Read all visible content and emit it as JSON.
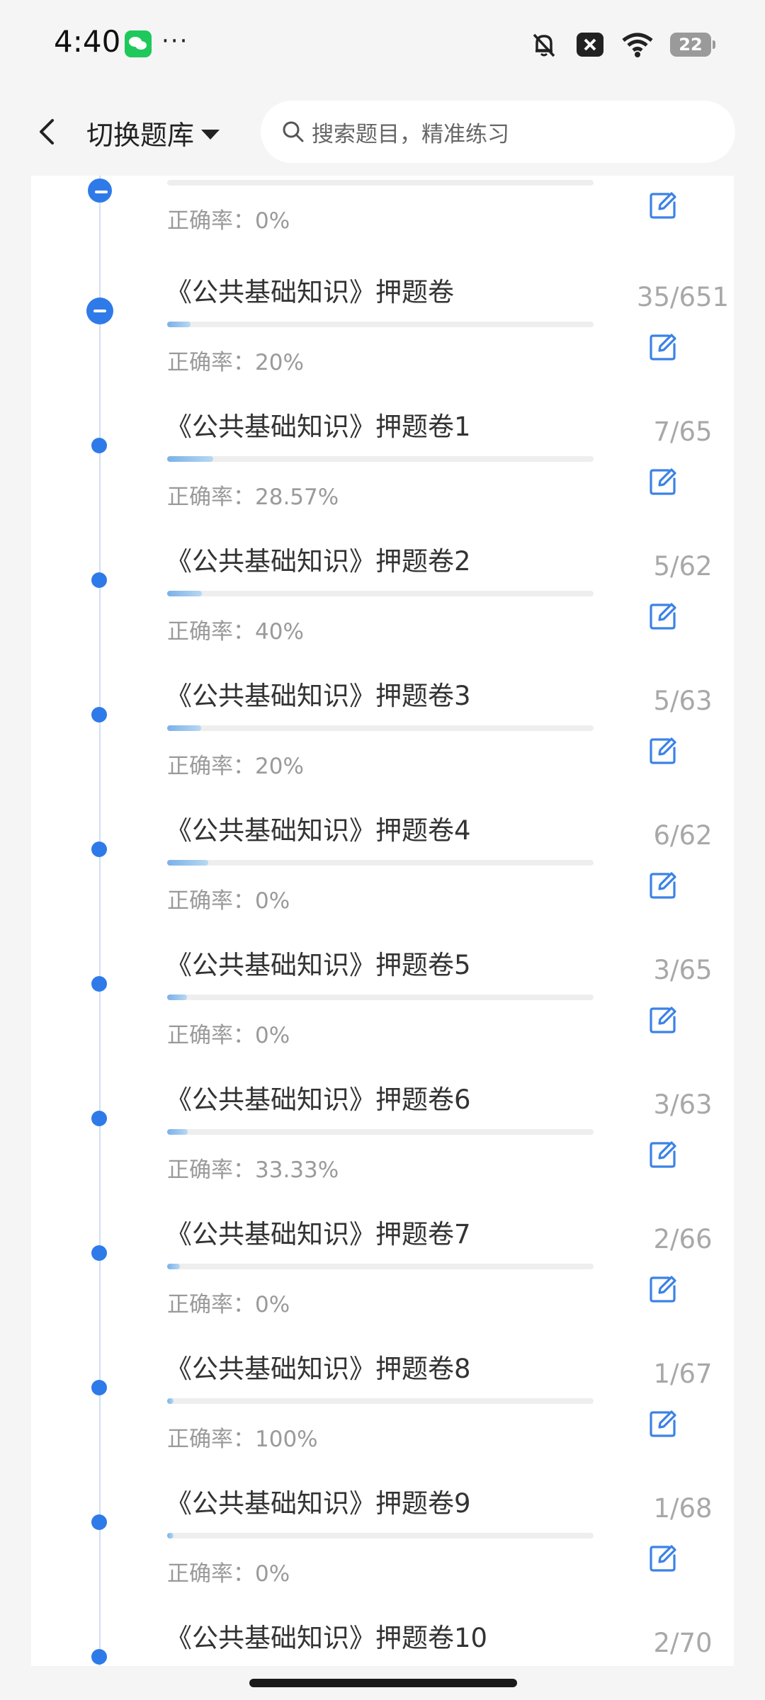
{
  "status_bar": {
    "time": "4:40",
    "battery": "22"
  },
  "header": {
    "switch_label": "切换题库",
    "search_placeholder": "搜索题目，精准练习"
  },
  "partial_item": {
    "accuracy": "正确率：0%"
  },
  "items": [
    {
      "title": "《公共基础知识》押题卷",
      "count": "35/651",
      "accuracy": "正确率：20%",
      "progress": 0.054,
      "expanded": true
    },
    {
      "title": "《公共基础知识》押题卷1",
      "count": "7/65",
      "accuracy": "正确率：28.57%",
      "progress": 0.108
    },
    {
      "title": "《公共基础知识》押题卷2",
      "count": "5/62",
      "accuracy": "正确率：40%",
      "progress": 0.081
    },
    {
      "title": "《公共基础知识》押题卷3",
      "count": "5/63",
      "accuracy": "正确率：20%",
      "progress": 0.079
    },
    {
      "title": "《公共基础知识》押题卷4",
      "count": "6/62",
      "accuracy": "正确率：0%",
      "progress": 0.097
    },
    {
      "title": "《公共基础知识》押题卷5",
      "count": "3/65",
      "accuracy": "正确率：0%",
      "progress": 0.046
    },
    {
      "title": "《公共基础知识》押题卷6",
      "count": "3/63",
      "accuracy": "正确率：33.33%",
      "progress": 0.048
    },
    {
      "title": "《公共基础知识》押题卷7",
      "count": "2/66",
      "accuracy": "正确率：0%",
      "progress": 0.03
    },
    {
      "title": "《公共基础知识》押题卷8",
      "count": "1/67",
      "accuracy": "正确率：100%",
      "progress": 0.015
    },
    {
      "title": "《公共基础知识》押题卷9",
      "count": "1/68",
      "accuracy": "正确率：0%",
      "progress": 0.015
    },
    {
      "title": "《公共基础知识》押题卷10",
      "count": "2/70",
      "accuracy": "",
      "progress": 0.029
    }
  ],
  "colors": {
    "accent": "#2f7ae9",
    "progress": "#7ab0e8",
    "muted": "#9a9a9a"
  },
  "icons": {
    "back": "chevron-left-icon",
    "caret": "caret-down-icon",
    "search": "search-icon",
    "edit": "edit-icon"
  }
}
